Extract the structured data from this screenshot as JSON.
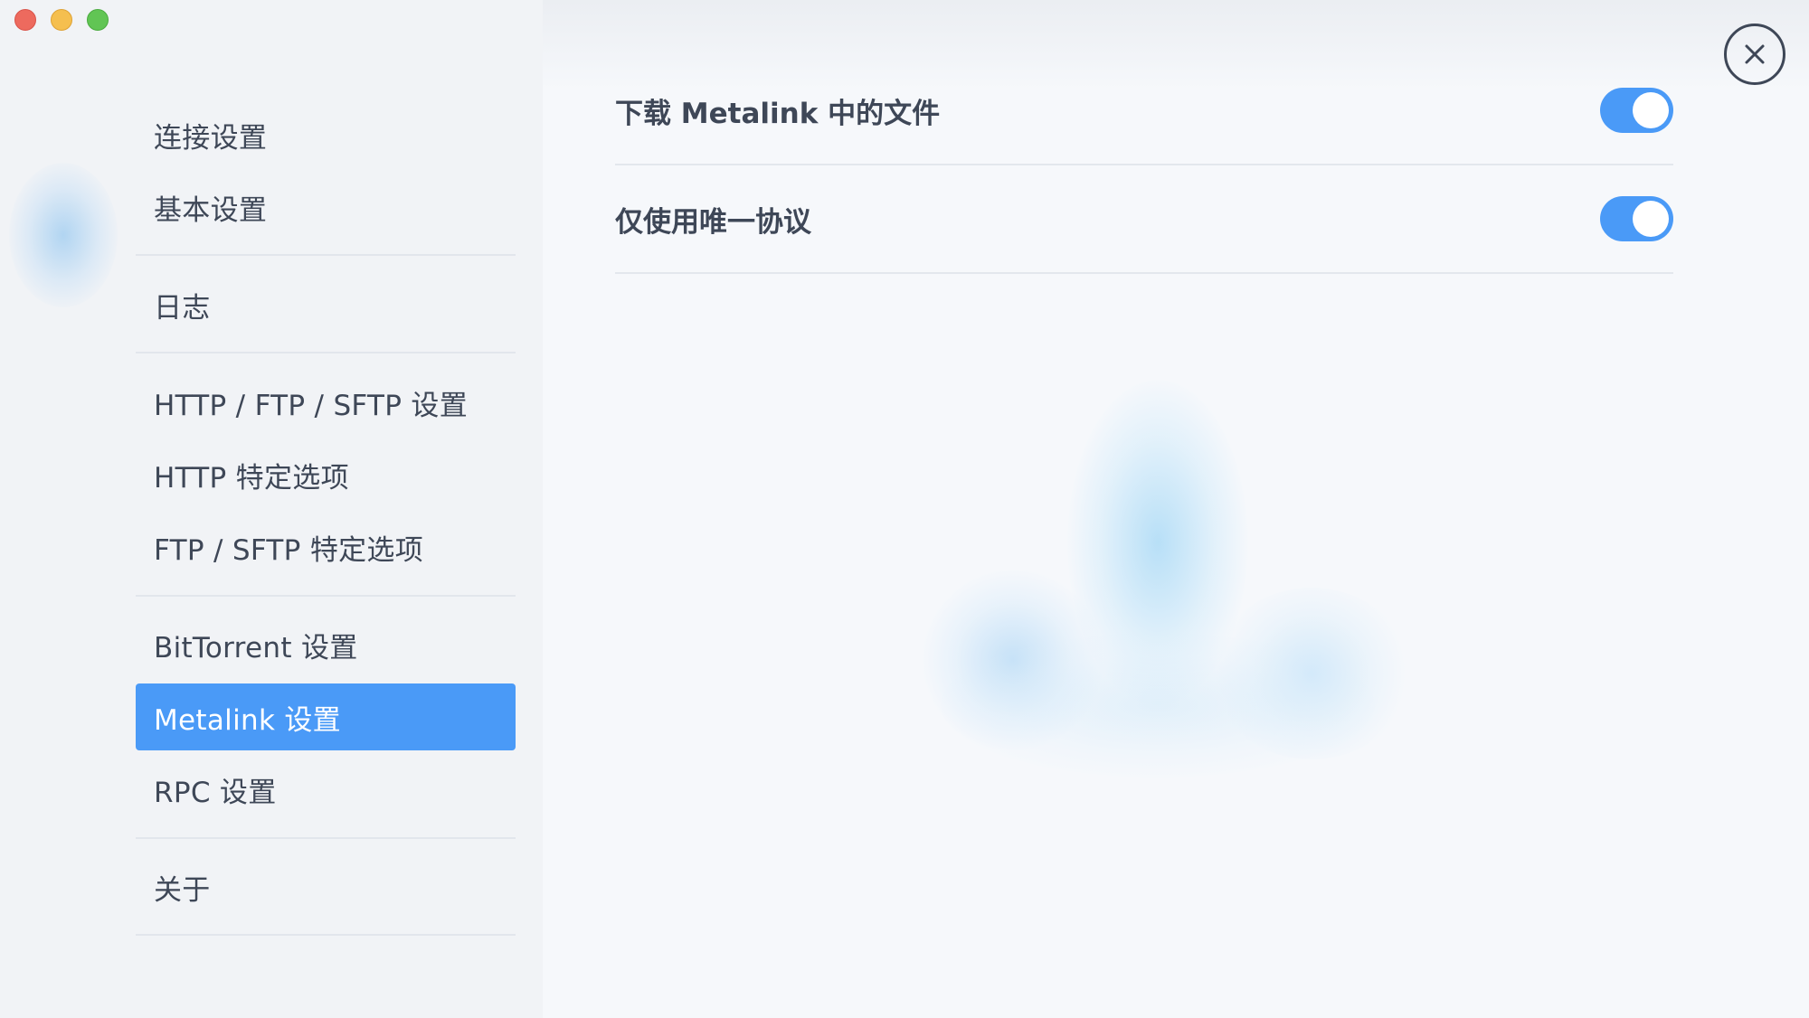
{
  "window": {
    "traffic_lights": [
      "close",
      "minimize",
      "maximize"
    ]
  },
  "sidebar": {
    "items": [
      {
        "label": "连接设置",
        "active": false
      },
      {
        "label": "基本设置",
        "active": false
      },
      {
        "label": "日志",
        "active": false
      },
      {
        "label": "HTTP / FTP / SFTP 设置",
        "active": false
      },
      {
        "label": "HTTP 特定选项",
        "active": false
      },
      {
        "label": "FTP / SFTP 特定选项",
        "active": false
      },
      {
        "label": "BitTorrent 设置",
        "active": false
      },
      {
        "label": "Metalink 设置",
        "active": true
      },
      {
        "label": "RPC 设置",
        "active": false
      },
      {
        "label": "关于",
        "active": false
      }
    ]
  },
  "main": {
    "settings": [
      {
        "label": "下载 Metalink 中的文件",
        "enabled": true
      },
      {
        "label": "仅使用唯一协议",
        "enabled": true
      }
    ]
  },
  "colors": {
    "accent": "#4a9af7",
    "text": "#3e4757",
    "divider": "#e2e6ec"
  },
  "icons": {
    "close": "close-icon"
  }
}
